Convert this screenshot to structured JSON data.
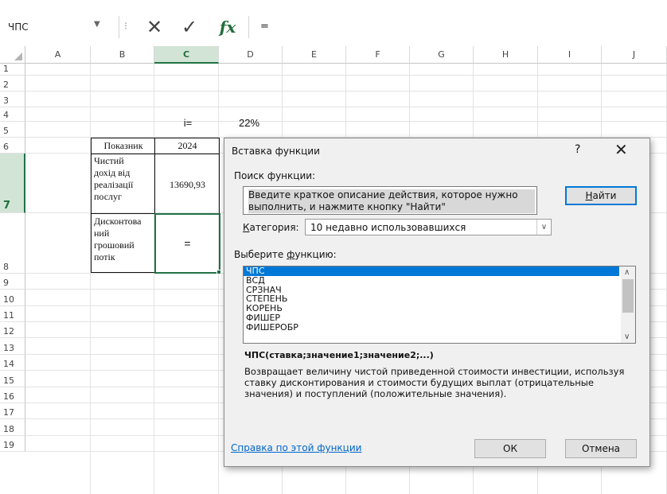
{
  "formula_bar": {
    "name_box": "ЧПС",
    "cancel_glyph": "✕",
    "enter_glyph": "✓",
    "fx_label": "fx",
    "formula": "="
  },
  "columns": [
    "A",
    "B",
    "C",
    "D",
    "E",
    "F",
    "G",
    "H",
    "I",
    "J"
  ],
  "selected_column": "C",
  "rows": [
    "1",
    "2",
    "3",
    "4",
    "5",
    "6",
    "7",
    "8",
    "9",
    "10",
    "11",
    "12",
    "13",
    "14",
    "15",
    "16",
    "17",
    "18",
    "19"
  ],
  "selected_row": "7",
  "cells": {
    "c4": "i=",
    "d4": "22%",
    "b5": "Показник",
    "c5": "2024",
    "b6": [
      "Чистий",
      "дохід від",
      "реалізації",
      "послуг"
    ],
    "c6": "13690,93",
    "b7": [
      "Дисконтова",
      "ний",
      "грошовий",
      "потік"
    ],
    "c7": "="
  },
  "dialog": {
    "title": "Вставка функции",
    "help_glyph": "?",
    "close_glyph": "✕",
    "search_label": "Поиск функции:",
    "search_text": "Введите краткое описание действия, которое нужно выполнить, и нажмите кнопку \"Найти\"",
    "find_button": {
      "pre": "",
      "u": "Н",
      "post": "айти"
    },
    "category_label": {
      "pre": "",
      "u": "К",
      "post": "атегория:"
    },
    "category_value": "10 недавно использовавшихся",
    "select_label": {
      "pre": "Выберите ",
      "u": "ф",
      "post": "ункцию:"
    },
    "functions": [
      "ЧПС",
      "ВСД",
      "СРЗНАЧ",
      "СТЕПЕНЬ",
      "КОРЕНЬ",
      "ФИШЕР",
      "ФИШЕРОБР"
    ],
    "selected_function": "ЧПС",
    "syntax": "ЧПС(ставка;значение1;значение2;...)",
    "description": "Возвращает величину чистой приведенной стоимости инвестиции, используя ставку дисконтирования и стоимости будущих выплат (отрицательные значения) и поступлений (положительные значения).",
    "help_link": "Справка по этой функции",
    "ok_label": "ОК",
    "cancel_label": "Отмена"
  },
  "colors": {
    "selection_accent": "#217346",
    "header_highlight": "#d2e4d6",
    "list_selection": "#0078d7",
    "link": "#0066cc"
  }
}
